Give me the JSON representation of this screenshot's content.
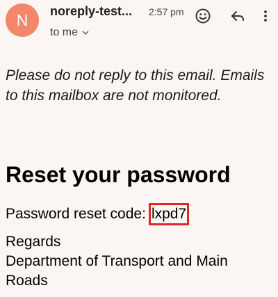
{
  "email": {
    "avatar_letter": "N",
    "sender": "noreply-test...",
    "time": "2:57 pm",
    "recipient": "to me",
    "notice": "Please do not reply to this email. Emails to this mailbox are not monitored.",
    "title": "Reset your password",
    "code_label": "Password reset code:",
    "code": "lxpd7",
    "regards": "Regards",
    "signature": "Department of Transport and Main Roads"
  },
  "colors": {
    "background": "#fbf6f3",
    "avatar": "#f4866a",
    "highlight_border": "#e0252b"
  },
  "icons": {
    "emoji": "smiley-icon",
    "reply": "reply-icon",
    "more": "more-vert-icon",
    "expand": "chevron-down-icon"
  }
}
